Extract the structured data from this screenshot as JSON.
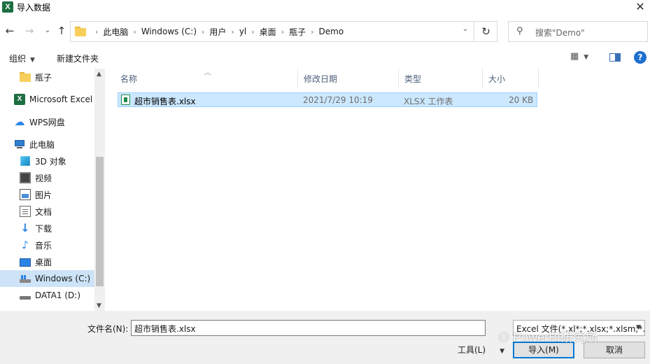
{
  "window": {
    "title": "导入数据",
    "app_icon": "X"
  },
  "nav_buttons": {
    "back": "←",
    "forward": "→",
    "recent": "⌄",
    "up": "↑",
    "refresh": "↻"
  },
  "address": {
    "crumbs": [
      "此电脑",
      "Windows (C:)",
      "用户",
      "yl",
      "桌面",
      "瓶子",
      "Demo"
    ],
    "dropdown": "⌄"
  },
  "search": {
    "placeholder": "搜索\"Demo\"",
    "icon": "⚲"
  },
  "toolbar": {
    "organize": "组织",
    "new_folder": "新建文件夹",
    "view_icon": "▦",
    "help": "?"
  },
  "navpane": {
    "items": [
      {
        "label": "瓶子",
        "icon": "folder-icon"
      },
      {
        "label": "Microsoft Excel",
        "icon": "excel-icon"
      },
      {
        "label": "WPS网盘",
        "icon": "cloud-icon"
      },
      {
        "label": "此电脑",
        "icon": "computer-icon"
      },
      {
        "label": "3D 对象",
        "icon": "3d-objects-icon"
      },
      {
        "label": "视频",
        "icon": "video-icon"
      },
      {
        "label": "图片",
        "icon": "pictures-icon"
      },
      {
        "label": "文档",
        "icon": "documents-icon"
      },
      {
        "label": "下载",
        "icon": "download-icon"
      },
      {
        "label": "音乐",
        "icon": "music-icon"
      },
      {
        "label": "桌面",
        "icon": "desktop-icon"
      },
      {
        "label": "Windows (C:)",
        "icon": "drive-c-icon"
      },
      {
        "label": "DATA1 (D:)",
        "icon": "drive-d-icon"
      }
    ]
  },
  "filelist": {
    "columns": [
      "名称",
      "修改日期",
      "类型",
      "大小"
    ],
    "rows": [
      {
        "name": "超市销售表.xlsx",
        "modified": "2021/7/29 10:19",
        "type": "XLSX 工作表",
        "size": "20 KB"
      }
    ]
  },
  "bottom": {
    "filename_label": "文件名(N):",
    "filename_value": "超市销售表.xlsx",
    "filter": "Excel 文件(*.xl*;*.xlsx;*.xlsm;*.",
    "tools": "工具(L)",
    "open": "导入(M)",
    "cancel": "取消"
  },
  "watermark": "PowerBI研究所",
  "colors": {
    "selection": "#cce8ff",
    "accent": "#0078d7",
    "excel_green": "#1d6f42",
    "folder": "#f7cf5a"
  }
}
